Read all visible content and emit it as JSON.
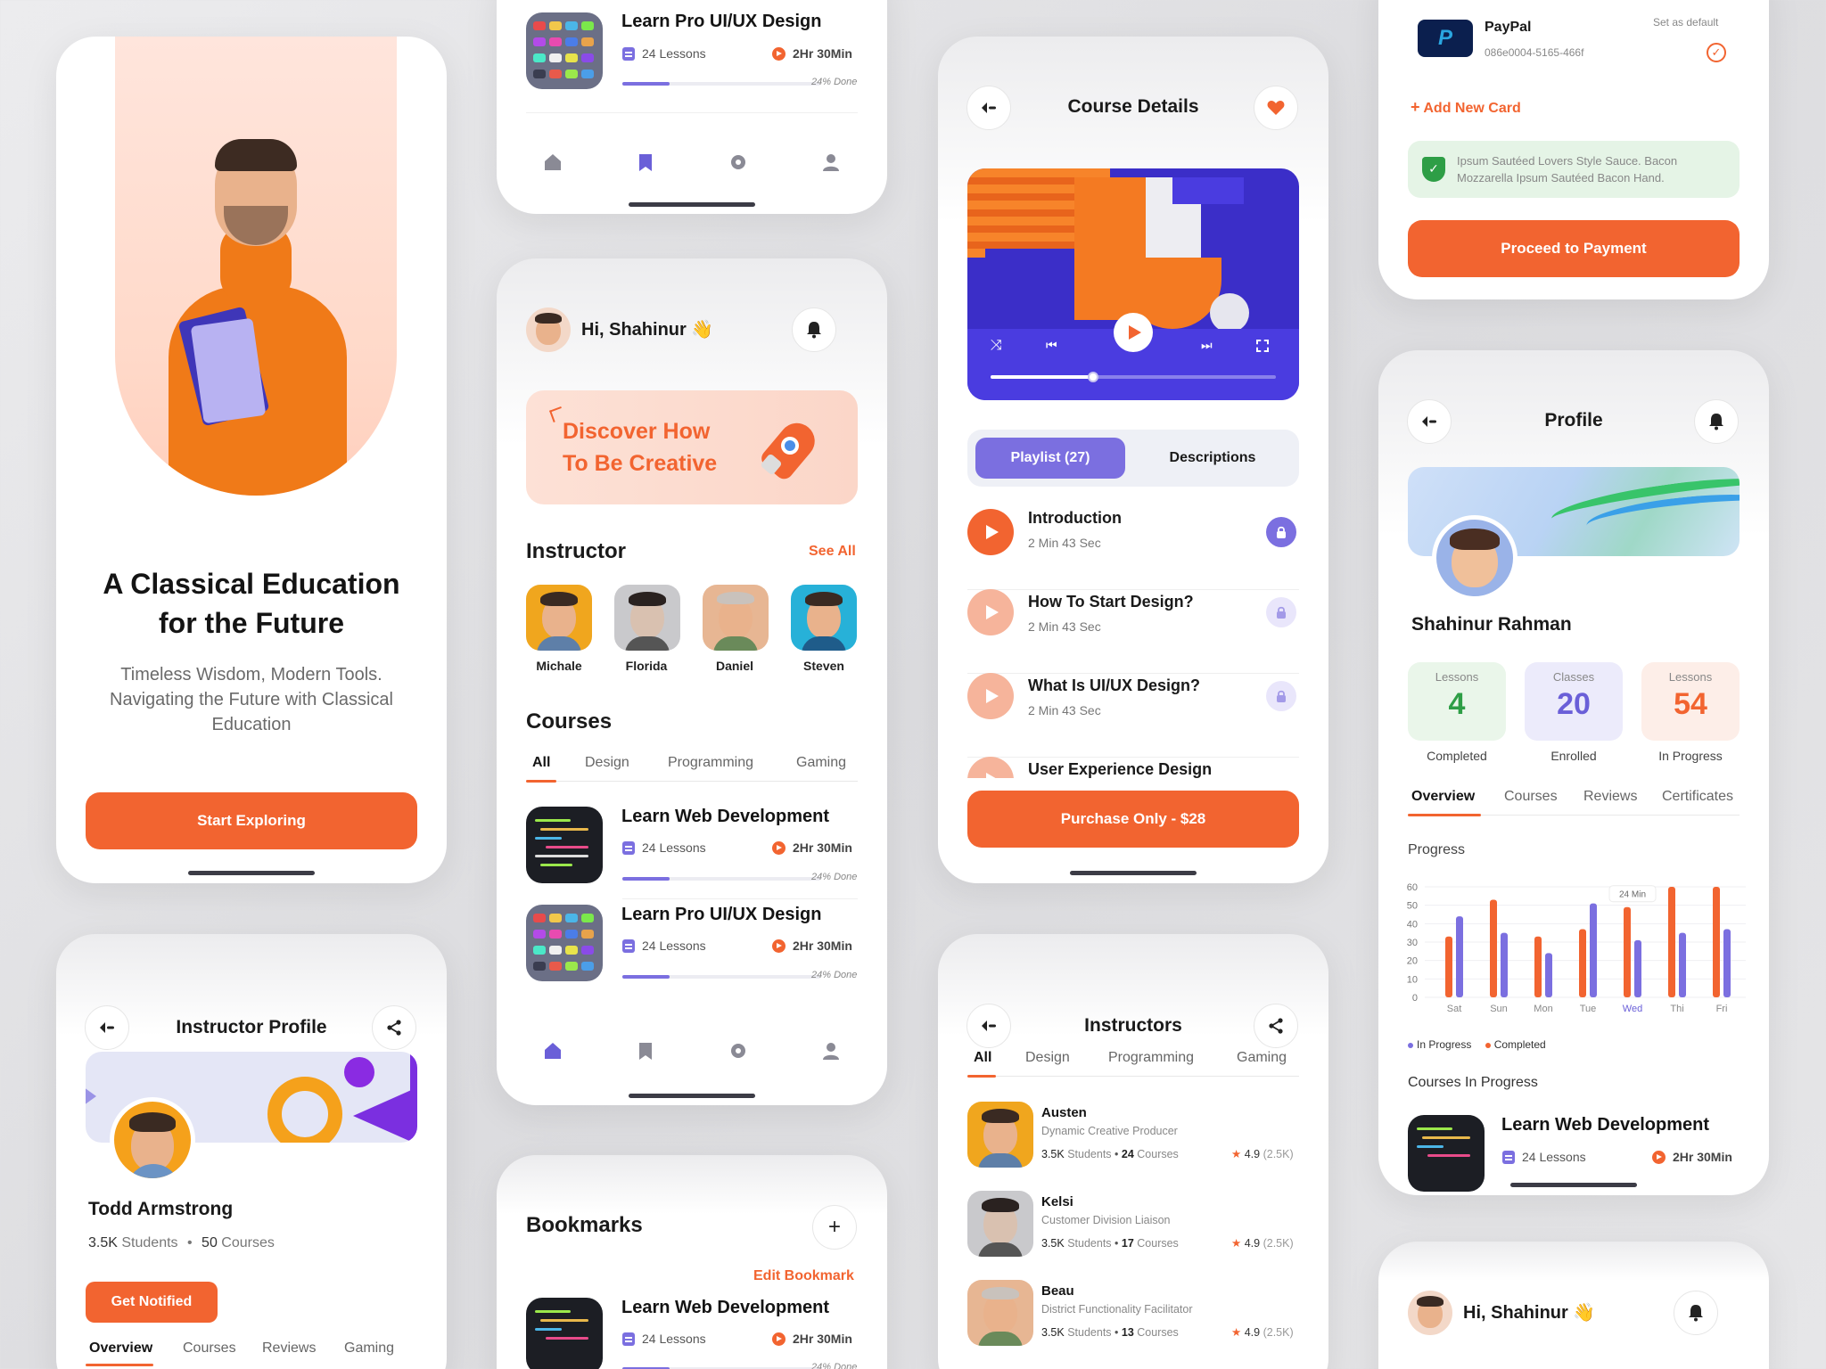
{
  "colors": {
    "accent": "#f26430",
    "purple": "#7b6fe0",
    "green": "#2e9e46"
  },
  "onboarding": {
    "title_line1": "A Classical Education",
    "title_line2": "for the Future",
    "subtitle_line1": "Timeless Wisdom, Modern Tools.",
    "subtitle_line2": "Navigating the Future with Classical",
    "subtitle_line3": "Education",
    "cta": "Start Exploring"
  },
  "instructor_profile": {
    "title": "Instructor Profile",
    "name": "Todd Armstrong",
    "students": "3.5K",
    "students_label": "Students",
    "courses": "50",
    "courses_label": "Courses",
    "cta": "Get Notified",
    "tabs": [
      "Overview",
      "Courses",
      "Reviews",
      "Gaming"
    ]
  },
  "top_course_card": {
    "course_title": "Learn Pro UI/UX Design",
    "lessons": "24 Lessons",
    "duration": "2Hr 30Min",
    "progress": 0.24,
    "progress_label": "24% Done"
  },
  "home": {
    "greeting": "Hi, Shahinur",
    "wave": "👋",
    "banner_line1": "Discover How",
    "banner_line2": "To Be Creative",
    "instructor_heading": "Instructor",
    "see_all": "See All",
    "instructors": [
      "Michale",
      "Florida",
      "Daniel",
      "Steven"
    ],
    "courses_heading": "Courses",
    "tabs": [
      "All",
      "Design",
      "Programming",
      "Gaming"
    ],
    "courses": [
      {
        "title": "Learn Web Development",
        "lessons": "24 Lessons",
        "duration": "2Hr 30Min",
        "progress": 0.24,
        "progress_label": "24% Done"
      },
      {
        "title": "Learn Pro UI/UX Design",
        "lessons": "24 Lessons",
        "duration": "2Hr 30Min",
        "progress": 0.24,
        "progress_label": "24% Done"
      }
    ]
  },
  "bookmarks": {
    "title": "Bookmarks",
    "edit": "Edit Bookmark",
    "course_title": "Learn Web Development",
    "lessons": "24 Lessons",
    "duration": "2Hr 30Min",
    "progress_label": "24% Done"
  },
  "course_details": {
    "title": "Course Details",
    "video_progress": 0.36,
    "tab_playlist": "Playlist (27)",
    "tab_descriptions": "Descriptions",
    "lessons": [
      {
        "title": "Introduction",
        "duration": "2 Min 43 Sec",
        "active": true
      },
      {
        "title": "How To Start Design?",
        "duration": "2 Min 43 Sec",
        "active": false
      },
      {
        "title": "What Is UI/UX Design?",
        "duration": "2 Min 43 Sec",
        "active": false
      },
      {
        "title": "User Experience Design",
        "duration": "",
        "active": false
      }
    ],
    "cta": "Purchase Only - $28"
  },
  "instructors_list": {
    "title": "Instructors",
    "tabs": [
      "All",
      "Design",
      "Programming",
      "Gaming"
    ],
    "items": [
      {
        "name": "Austen",
        "role": "Dynamic Creative Producer",
        "students": "3.5K",
        "students_label": "Students",
        "courses": "24",
        "courses_label": "Courses",
        "rating": "4.9",
        "reviews": "(2.5K)"
      },
      {
        "name": "Kelsi",
        "role": "Customer Division Liaison",
        "students": "3.5K",
        "students_label": "Students",
        "courses": "17",
        "courses_label": "Courses",
        "rating": "4.9",
        "reviews": "(2.5K)"
      },
      {
        "name": "Beau",
        "role": "District Functionality Facilitator",
        "students": "3.5K",
        "students_label": "Students",
        "courses": "13",
        "courses_label": "Courses",
        "rating": "4.9",
        "reviews": "(2.5K)"
      }
    ]
  },
  "payment": {
    "method_name": "PayPal",
    "method_id": "086e0004-5165-466f",
    "default_label": "Set as default",
    "add_card": "Add New Card",
    "notice_line1": "Ipsum Sautéed Lovers Style Sauce. Bacon",
    "notice_line2": "Mozzarella Ipsum Sautéed Bacon Hand.",
    "cta": "Proceed to Payment"
  },
  "profile": {
    "title": "Profile",
    "name": "Shahinur Rahman",
    "stats": [
      {
        "label": "Lessons",
        "value": "4",
        "caption": "Completed",
        "color": "#2e9e46"
      },
      {
        "label": "Classes",
        "value": "20",
        "caption": "Enrolled",
        "color": "#6a5fd8"
      },
      {
        "label": "Lessons",
        "value": "54",
        "caption": "In Progress",
        "color": "#f26430"
      }
    ],
    "tabs": [
      "Overview",
      "Courses",
      "Reviews",
      "Certificates"
    ],
    "progress_heading": "Progress",
    "tooltip": "24 Min",
    "legend_in_progress": "In Progress",
    "legend_completed": "Completed",
    "courses_in_progress": "Courses In Progress",
    "course_title": "Learn Web Development",
    "lessons": "24 Lessons",
    "duration": "2Hr 30Min"
  },
  "mini_home": {
    "greeting": "Hi, Shahinur",
    "wave": "👋"
  },
  "chart_data": {
    "type": "bar",
    "categories": [
      "Sat",
      "Sun",
      "Mon",
      "Tue",
      "Wed",
      "Thi",
      "Fri"
    ],
    "series": [
      {
        "name": "Completed",
        "color": "#f26430",
        "values": [
          33,
          53,
          33,
          37,
          49,
          60,
          60
        ]
      },
      {
        "name": "In Progress",
        "color": "#7b6fe0",
        "values": [
          44,
          35,
          24,
          51,
          31,
          35,
          37
        ]
      }
    ],
    "yticks": [
      0,
      10,
      20,
      30,
      40,
      50,
      60
    ],
    "ylim": [
      0,
      60
    ],
    "highlight_category": "Wed"
  }
}
